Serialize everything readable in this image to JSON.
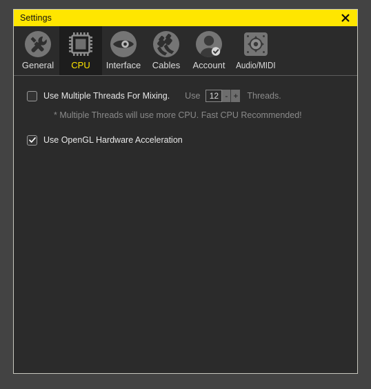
{
  "window": {
    "title": "Settings",
    "close_icon": "close-x-icon",
    "titlebar_color": "#ffe600",
    "body_color": "#2b2b2b",
    "accent_color": "#ffe600"
  },
  "tabs": [
    {
      "label": "General",
      "icon": "tools-icon",
      "selected": false
    },
    {
      "label": "CPU",
      "icon": "cpu-chip-icon",
      "selected": true
    },
    {
      "label": "Interface",
      "icon": "eye-icon",
      "selected": false
    },
    {
      "label": "Cables",
      "icon": "audio-plugs-icon",
      "selected": false
    },
    {
      "label": "Account",
      "icon": "user-check-icon",
      "selected": false
    },
    {
      "label": "Audio/MIDI",
      "icon": "speaker-icon",
      "selected": false
    }
  ],
  "settings": {
    "multithread": {
      "label": "Use Multiple Threads For Mixing.",
      "checked": false,
      "checkmark": ""
    },
    "threads_spinner": {
      "prefix": "Use",
      "value": "12",
      "decrement": "-",
      "increment": "+",
      "suffix": "Threads."
    },
    "hint": "* Multiple Threads will use more CPU. Fast CPU Recommended!",
    "opengl": {
      "label": "Use OpenGL Hardware Acceleration",
      "checked": true,
      "checkmark": "✔"
    }
  }
}
